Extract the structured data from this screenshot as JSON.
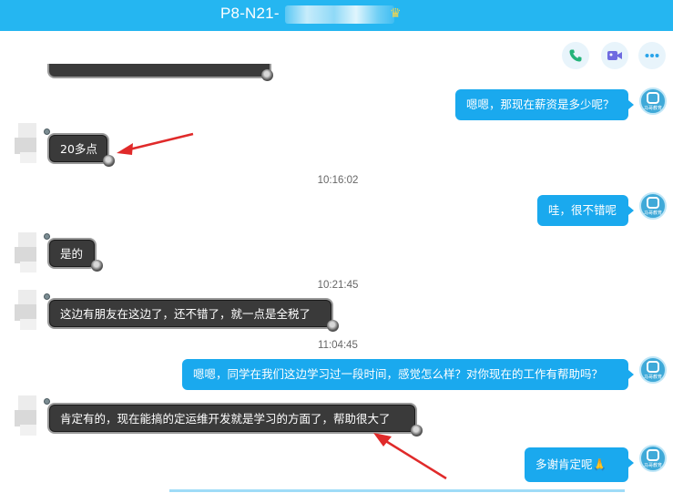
{
  "window": {
    "title": "P8-N21-"
  },
  "actions": {
    "phone": "phone-icon",
    "video": "video-icon",
    "more": "more-icon"
  },
  "messages": [
    {
      "side": "right",
      "text": "嗯嗯，那现在薪资是多少呢？"
    },
    {
      "side": "left",
      "text": "20多点"
    },
    {
      "time": "10:16:02"
    },
    {
      "side": "right",
      "text": "哇，很不错呢"
    },
    {
      "side": "left",
      "text": "是的"
    },
    {
      "time": "10:21:45"
    },
    {
      "side": "left",
      "text": "这边有朋友在这边了，还不错了，就一点是全税了"
    },
    {
      "time": "11:04:45"
    },
    {
      "side": "right",
      "text": "嗯嗯，同学在我们这边学习过一段时间，感觉怎么样？对你现在的工作有帮助吗？"
    },
    {
      "side": "left",
      "text": "肯定有的，现在能搞的定运维开发就是学习的方面了，帮助很大了"
    },
    {
      "side": "right",
      "text": "多谢肯定呢🙏"
    }
  ],
  "colors": {
    "titlebar": "#25b6f1",
    "right_bubble": "#1aa9ee",
    "left_bubble": "#3a3a3a",
    "annotation_arrow": "#e02a2a"
  },
  "avatar": {
    "right_caption": "马哥教育"
  }
}
